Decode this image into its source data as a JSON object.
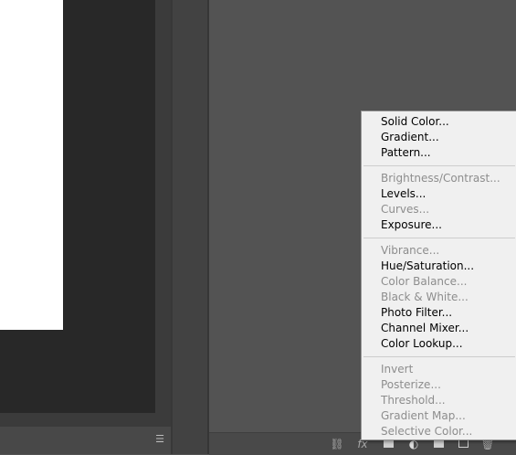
{
  "left_status": {
    "menu_icon": "hamburger-icon"
  },
  "footer": {
    "buttons": [
      {
        "icon": "link-icon",
        "glyph": "⛓"
      },
      {
        "icon": "fx-icon",
        "glyph": "fx"
      },
      {
        "icon": "mask-icon"
      },
      {
        "icon": "adjustment-layer-icon",
        "glyph": "◐"
      },
      {
        "icon": "group-folder-icon"
      },
      {
        "icon": "new-layer-icon"
      },
      {
        "icon": "trash-icon",
        "glyph": "🗑"
      }
    ]
  },
  "menu": {
    "groups": [
      [
        {
          "label": "Solid Color...",
          "enabled": true
        },
        {
          "label": "Gradient...",
          "enabled": true
        },
        {
          "label": "Pattern...",
          "enabled": true
        }
      ],
      [
        {
          "label": "Brightness/Contrast...",
          "enabled": false
        },
        {
          "label": "Levels...",
          "enabled": true
        },
        {
          "label": "Curves...",
          "enabled": false
        },
        {
          "label": "Exposure...",
          "enabled": true
        }
      ],
      [
        {
          "label": "Vibrance...",
          "enabled": false
        },
        {
          "label": "Hue/Saturation...",
          "enabled": true
        },
        {
          "label": "Color Balance...",
          "enabled": false
        },
        {
          "label": "Black & White...",
          "enabled": false
        },
        {
          "label": "Photo Filter...",
          "enabled": true
        },
        {
          "label": "Channel Mixer...",
          "enabled": true
        },
        {
          "label": "Color Lookup...",
          "enabled": true
        }
      ],
      [
        {
          "label": "Invert",
          "enabled": false
        },
        {
          "label": "Posterize...",
          "enabled": false
        },
        {
          "label": "Threshold...",
          "enabled": false
        },
        {
          "label": "Gradient Map...",
          "enabled": false
        },
        {
          "label": "Selective Color...",
          "enabled": false
        }
      ]
    ]
  },
  "colors": {
    "canvas_bg": "#282828",
    "document": "#ffffff",
    "panel_bg": "#535353",
    "menu_bg": "#f0f0f0",
    "disabled_text": "#8d8d8d"
  }
}
